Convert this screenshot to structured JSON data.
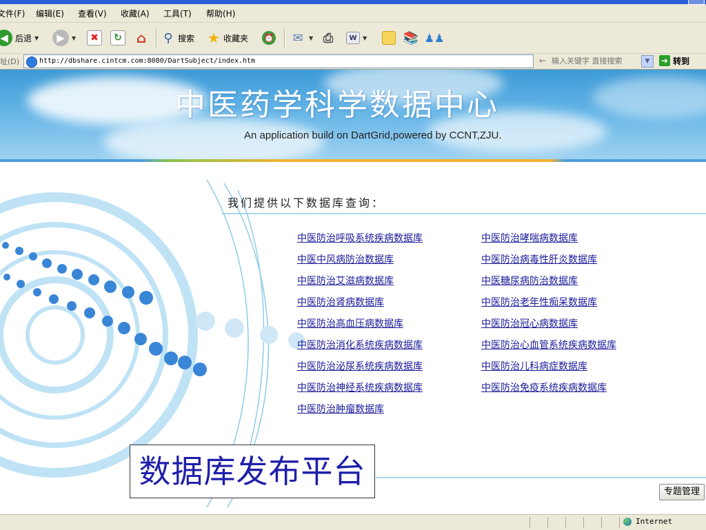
{
  "menubar": {
    "items": [
      "文件(F)",
      "编辑(E)",
      "查看(V)",
      "收藏(A)",
      "工具(T)",
      "帮助(H)"
    ]
  },
  "toolbar": {
    "back_label": "后退",
    "search_label": "搜索",
    "favorites_label": "收藏夹"
  },
  "address": {
    "label": "址(D)",
    "url": "http://dbshare.cintcm.com:8080/DartSubject/index.htm",
    "search_placeholder": "输入关键字 直接搜索",
    "go_label": "转到"
  },
  "banner": {
    "title": "中医药学科学数据中心",
    "subtitle": "An application build on DartGrid,powered by CCNT,ZJU."
  },
  "main": {
    "intro": "我们提供以下数据库查询：",
    "left_links": [
      "中医防治呼吸系统疾病数据库",
      "中医中风病防治数据库",
      "中医防治艾滋病数据库",
      "中医防治肾病数据库",
      "中医防治高血压病数据库",
      "中医防治消化系统疾病数据库",
      "中医防治泌尿系统疾病数据库",
      "中医防治神经系统疾病数据库",
      "中医防治肿瘤数据库"
    ],
    "right_links": [
      "中医防治哮喘病数据库",
      "中医防治病毒性肝炎数据库",
      "中医糖尿病防治数据库",
      "中医防治老年性痴呆数据库",
      "中医防治冠心病数据库",
      "中医防治心血管系统疾病数据库",
      "中医防治儿科病症数据库",
      "中医防治免疫系统疾病数据库"
    ],
    "platform_label": "数据库发布平台",
    "manage_button": "专题管理"
  },
  "statusbar": {
    "zone": "Internet"
  },
  "colors": {
    "link": "#1a1a99",
    "platform_text": "#1f1faa",
    "banner_sky": "#3d9ad6",
    "stripe_orange": "#f2b233"
  }
}
